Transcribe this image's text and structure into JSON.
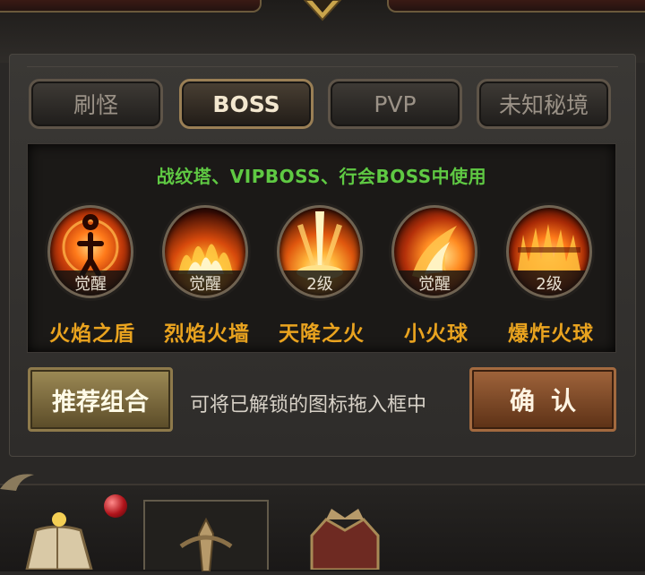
{
  "tabs": [
    {
      "label": "刷怪",
      "active": false
    },
    {
      "label": "BOSS",
      "active": true
    },
    {
      "label": "PVP",
      "active": false
    },
    {
      "label": "未知秘境",
      "active": false
    }
  ],
  "usage_hint": "战纹塔、VIPBOSS、行会BOSS中使用",
  "skills": [
    {
      "name": "火焰之盾",
      "tag": "觉醒",
      "icon": "fire-shield-icon"
    },
    {
      "name": "烈焰火墙",
      "tag": "觉醒",
      "icon": "flame-wall-icon"
    },
    {
      "name": "天降之火",
      "tag": "2级",
      "icon": "falling-fire-icon"
    },
    {
      "name": "小火球",
      "tag": "觉醒",
      "icon": "fireball-icon"
    },
    {
      "name": "爆炸火球",
      "tag": "2级",
      "icon": "explosive-fireball-icon"
    }
  ],
  "recommend_label": "推荐组合",
  "drag_hint": "可将已解锁的图标拖入框中",
  "confirm_label": "确认",
  "colors": {
    "skill_name": "#e9a31f",
    "usage_hint": "#5fc943",
    "confirm_button": "#8a5330",
    "recommend_button": "#7e6c3f"
  }
}
